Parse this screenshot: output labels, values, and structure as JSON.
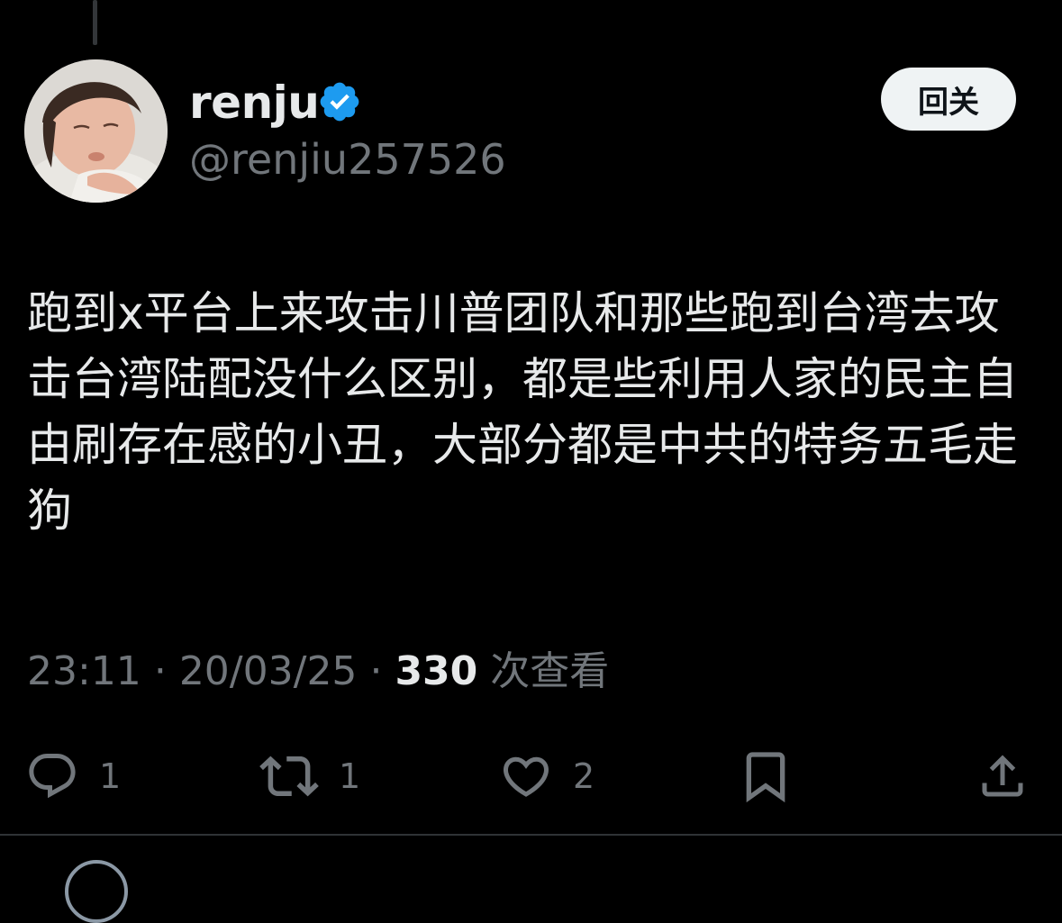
{
  "tweet": {
    "author": {
      "display_name": "renju",
      "handle": "@renjiu257526",
      "verified": true,
      "avatar": "avatar-child-photo"
    },
    "follow_label": "回关",
    "text": "跑到x平台上来攻击川普团队和那些跑到台湾去攻击台湾陆配没什么区别，都是些利用人家的民主自由刷存在感的小丑，大部分都是中共的特务五毛走狗",
    "time": "23:11",
    "separator": "·",
    "date": "20/03/25",
    "views_count": "330",
    "views_label": "次查看",
    "actions": {
      "reply": {
        "icon": "reply-icon",
        "count": "1"
      },
      "retweet": {
        "icon": "retweet-icon",
        "count": "1"
      },
      "like": {
        "icon": "heart-icon",
        "count": "2"
      },
      "bookmark": {
        "icon": "bookmark-icon"
      },
      "share": {
        "icon": "share-icon"
      }
    }
  },
  "colors": {
    "background": "#000000",
    "text_primary": "#e7e9ea",
    "text_secondary": "#71767b",
    "verified_blue": "#1d9bf0",
    "button_bg": "#eff3f4"
  }
}
